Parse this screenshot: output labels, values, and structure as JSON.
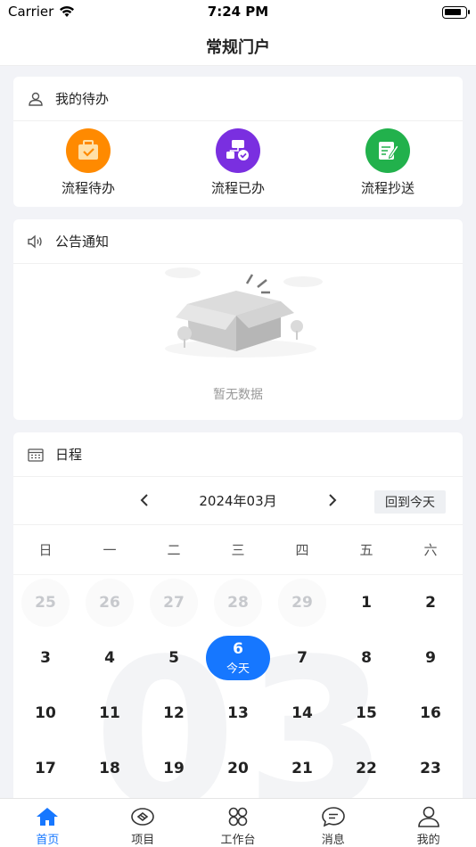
{
  "status_bar": {
    "carrier": "Carrier",
    "time": "7:24 PM"
  },
  "nav": {
    "title": "常规门户"
  },
  "todo": {
    "title": "我的待办",
    "items": [
      {
        "label": "流程待办",
        "color": "#ff8a00",
        "icon": "briefcase-check-icon"
      },
      {
        "label": "流程已办",
        "color": "#7a2fe0",
        "icon": "flowchart-check-icon"
      },
      {
        "label": "流程抄送",
        "color": "#22b14c",
        "icon": "document-edit-icon"
      }
    ]
  },
  "notice": {
    "title": "公告通知",
    "empty_text": "暂无数据"
  },
  "schedule": {
    "title": "日程",
    "month_label": "2024年03月",
    "today_button": "回到今天",
    "background_month": "03",
    "weekdays": [
      "日",
      "一",
      "二",
      "三",
      "四",
      "五",
      "六"
    ],
    "weeks": [
      [
        {
          "d": "25",
          "other": true
        },
        {
          "d": "26",
          "other": true
        },
        {
          "d": "27",
          "other": true
        },
        {
          "d": "28",
          "other": true
        },
        {
          "d": "29",
          "other": true
        },
        {
          "d": "1"
        },
        {
          "d": "2"
        }
      ],
      [
        {
          "d": "3"
        },
        {
          "d": "4"
        },
        {
          "d": "5"
        },
        {
          "d": "6",
          "today": true,
          "sub": "今天"
        },
        {
          "d": "7"
        },
        {
          "d": "8"
        },
        {
          "d": "9"
        }
      ],
      [
        {
          "d": "10"
        },
        {
          "d": "11"
        },
        {
          "d": "12"
        },
        {
          "d": "13"
        },
        {
          "d": "14"
        },
        {
          "d": "15"
        },
        {
          "d": "16"
        }
      ],
      [
        {
          "d": "17"
        },
        {
          "d": "18"
        },
        {
          "d": "19"
        },
        {
          "d": "20"
        },
        {
          "d": "21"
        },
        {
          "d": "22"
        },
        {
          "d": "23"
        }
      ]
    ]
  },
  "tabs": [
    {
      "label": "首页",
      "icon": "home-icon",
      "active": true
    },
    {
      "label": "项目",
      "icon": "project-icon",
      "active": false
    },
    {
      "label": "工作台",
      "icon": "workbench-icon",
      "active": false
    },
    {
      "label": "消息",
      "icon": "message-icon",
      "active": false
    },
    {
      "label": "我的",
      "icon": "user-icon",
      "active": false
    }
  ],
  "colors": {
    "accent": "#1677ff"
  }
}
